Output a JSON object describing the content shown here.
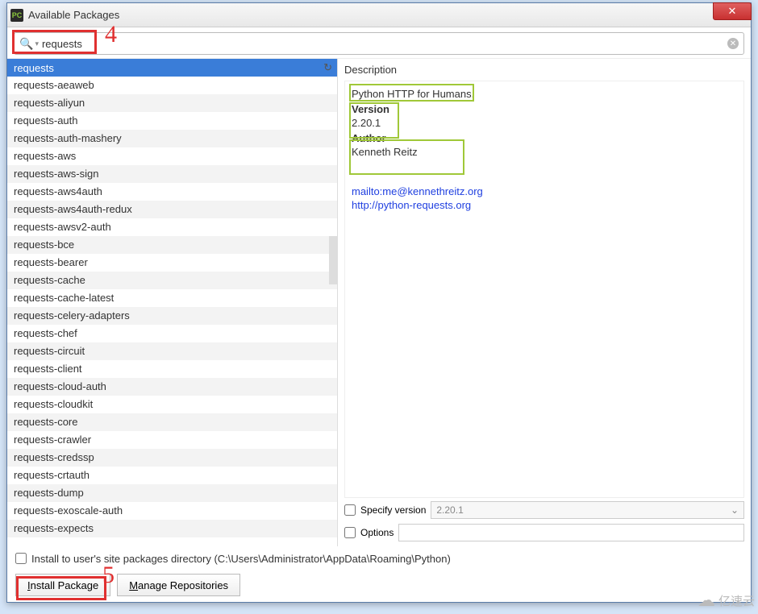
{
  "window": {
    "title": "Available Packages"
  },
  "search": {
    "value": "requests",
    "placeholder": ""
  },
  "annotations": {
    "mark4": "4",
    "mark5": "5"
  },
  "packages": [
    "requests",
    "requests-aeaweb",
    "requests-aliyun",
    "requests-auth",
    "requests-auth-mashery",
    "requests-aws",
    "requests-aws-sign",
    "requests-aws4auth",
    "requests-aws4auth-redux",
    "requests-awsv2-auth",
    "requests-bce",
    "requests-bearer",
    "requests-cache",
    "requests-cache-latest",
    "requests-celery-adapters",
    "requests-chef",
    "requests-circuit",
    "requests-client",
    "requests-cloud-auth",
    "requests-cloudkit",
    "requests-core",
    "requests-crawler",
    "requests-credssp",
    "requests-crtauth",
    "requests-dump",
    "requests-exoscale-auth",
    "requests-expects"
  ],
  "selected": "requests",
  "description": {
    "header": "Description",
    "summary": "Python HTTP for Humans.",
    "version_label": "Version",
    "version": "2.20.1",
    "author_label": "Author",
    "author": "Kenneth Reitz",
    "mailto": "mailto:me@kennethreitz.org",
    "homepage": "http://python-requests.org"
  },
  "options": {
    "specify_version_label": "Specify version",
    "specify_version_value": "2.20.1",
    "options_label": "Options",
    "user_site_label": "Install to user's site packages directory (C:\\Users\\Administrator\\AppData\\Roaming\\Python)"
  },
  "buttons": {
    "install": "Install Package",
    "manage": "Manage Repositories"
  },
  "watermark": "亿速云"
}
